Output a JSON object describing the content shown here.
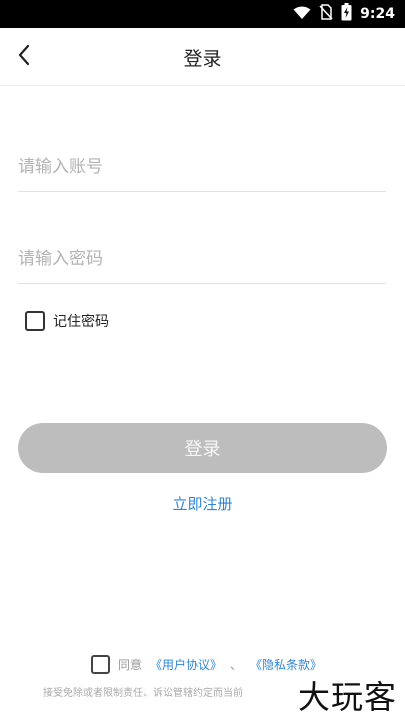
{
  "status_bar": {
    "time": "9:24",
    "icons": [
      "wifi-icon",
      "no-sim-icon",
      "battery-charging-icon"
    ],
    "background": "#000000"
  },
  "header": {
    "back_icon": "chevron-left-icon",
    "title": "登录"
  },
  "form": {
    "account_placeholder": "请输入账号",
    "account_value": "",
    "password_placeholder": "请输入密码",
    "password_value": "",
    "remember_label": "记住密码",
    "remember_checked": false
  },
  "login_button": {
    "label": "登录",
    "color": "#bdbdbd"
  },
  "register": {
    "label": "立即注册",
    "color": "#2f86d6"
  },
  "agreement": {
    "checked": false,
    "prefix": "同意",
    "user_agreement": "《用户协议》",
    "separator": "、",
    "privacy_policy": "《隐私条款》",
    "disclaimer": "接受免除或者限制责任、诉讼管辖约定而当前"
  },
  "watermark": {
    "text": "大玩客"
  }
}
